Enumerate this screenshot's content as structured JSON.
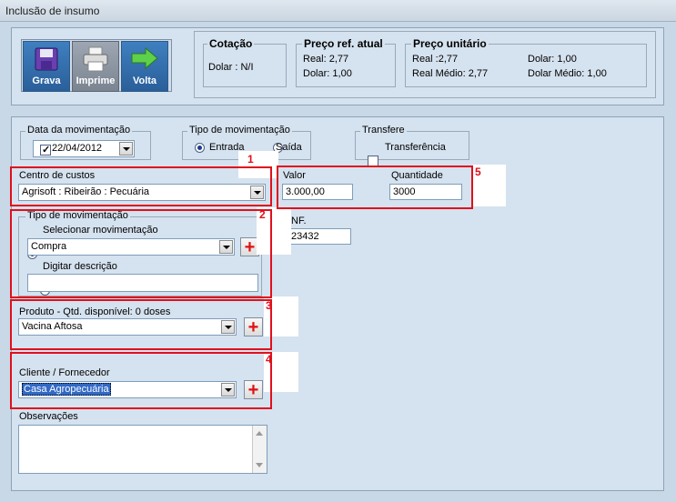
{
  "window": {
    "title": "Inclusão de insumo"
  },
  "toolbar": {
    "save_label": "Grava",
    "print_label": "Imprime",
    "back_label": "Volta"
  },
  "cotacao": {
    "title": "Cotação",
    "value": "Dolar : N/I"
  },
  "preco_ref": {
    "title": "Preço ref. atual",
    "real": "Real: 2,77",
    "dolar": "Dolar: 1,00"
  },
  "preco_unit": {
    "title": "Preço unitário",
    "real": "Real :2,77",
    "dolar": "Dolar: 1,00",
    "real_medio": "Real Médio: 2,77",
    "dolar_medio": "Dolar Médio: 1,00"
  },
  "data_mov": {
    "label": "Data da movimentação",
    "value": "22/04/2012"
  },
  "tipo_mov_top": {
    "label": "Tipo de movimentação",
    "entrada": "Entrada",
    "saida": "Saída"
  },
  "transfere": {
    "label": "Transfere",
    "option": "Transferência"
  },
  "centro": {
    "label": "Centro de custos",
    "value": "Agrisoft : Ribeirão : Pecuária"
  },
  "valor": {
    "label": "Valor",
    "value": "3.000,00"
  },
  "quantidade": {
    "label": "Quantidade",
    "value": "3000"
  },
  "nf": {
    "label": "NF.",
    "value": "23432"
  },
  "tipo_mov": {
    "label": "Tipo de movimentação",
    "opt_select": "Selecionar movimentação",
    "combo_value": "Compra",
    "opt_digitar": "Digitar descrição",
    "desc_value": ""
  },
  "produto": {
    "label": "Produto - Qtd. disponível: 0 doses",
    "value": "Vacina Aftosa"
  },
  "cliente": {
    "label": "Cliente / Fornecedor",
    "value": "Casa Agropecuária"
  },
  "observacoes": {
    "label": "Observações",
    "value": ""
  },
  "annotations": {
    "n1": "1",
    "n2": "2",
    "n3": "3",
    "n4": "4",
    "n5": "5"
  },
  "plus_symbol": "+"
}
